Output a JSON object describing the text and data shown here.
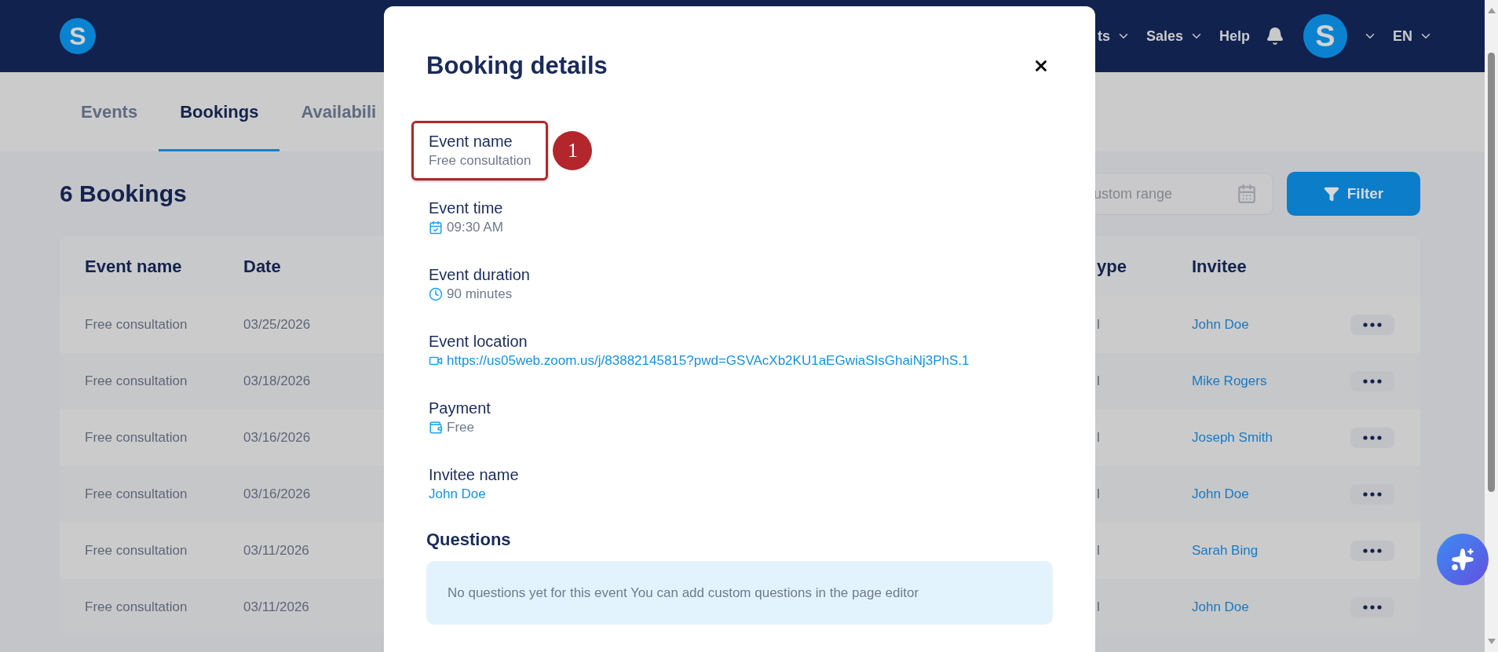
{
  "header": {
    "logo": "S",
    "nav": [
      {
        "label": "ts",
        "dropdown": true
      },
      {
        "label": "Sales",
        "dropdown": true
      },
      {
        "label": "Help",
        "dropdown": false
      }
    ],
    "avatar": "S",
    "language": "EN"
  },
  "tabs": [
    {
      "label": "Events",
      "selected": false
    },
    {
      "label": "Bookings",
      "selected": true
    },
    {
      "label": "Availabili",
      "selected": false
    }
  ],
  "page": {
    "title": "6 Bookings",
    "date_range": {
      "placeholder": "ustom range"
    },
    "filter_button": "Filter"
  },
  "table": {
    "columns": [
      "Event name",
      "Date",
      "ype",
      "Invitee"
    ],
    "rows": [
      {
        "event_name": "Free consultation",
        "date": "03/25/2026",
        "column_3": "l",
        "invitee": "John Doe"
      },
      {
        "event_name": "Free consultation",
        "date": "03/18/2026",
        "column_3": "l",
        "invitee": "Mike Rogers"
      },
      {
        "event_name": "Free consultation",
        "date": "03/16/2026",
        "column_3": "l",
        "invitee": "Joseph Smith"
      },
      {
        "event_name": "Free consultation",
        "date": "03/16/2026",
        "column_3": "l",
        "invitee": "John Doe"
      },
      {
        "event_name": "Free consultation",
        "date": "03/11/2026",
        "column_3": "l",
        "invitee": "Sarah Bing"
      },
      {
        "event_name": "Free consultation",
        "date": "03/11/2026",
        "column_3": "l",
        "invitee": "John Doe"
      }
    ]
  },
  "modal": {
    "title": "Booking details",
    "fields": [
      {
        "label": "Event name",
        "value": "Free consultation",
        "kind": "plain",
        "highlighted": true,
        "callout": "1"
      },
      {
        "label": "Event time",
        "value": "09:30 AM",
        "kind": "time",
        "highlighted": false
      },
      {
        "label": "Event duration",
        "value": "90 minutes",
        "kind": "duration",
        "highlighted": false
      },
      {
        "label": "Event location",
        "value": "https://us05web.zoom.us/j/83882145815?pwd=GSVAcXb2KU1aEGwiaSIsGhaiNj3PhS.1",
        "kind": "location",
        "highlighted": false
      },
      {
        "label": "Payment",
        "value": "Free",
        "kind": "payment",
        "highlighted": false
      },
      {
        "label": "Invitee name",
        "value": "John Doe",
        "kind": "person",
        "highlighted": false
      }
    ],
    "questions": {
      "heading": "Questions",
      "empty_text": "No questions yet for this event You can add custom questions in the page editor"
    }
  }
}
